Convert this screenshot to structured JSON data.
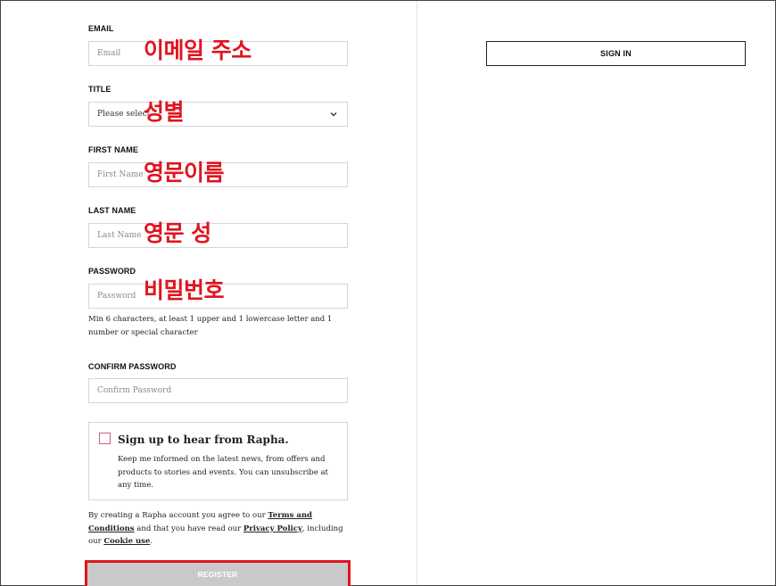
{
  "form": {
    "email": {
      "label": "EMAIL",
      "placeholder": "Email",
      "annotation": "이메일 주소"
    },
    "title": {
      "label": "TITLE",
      "selected": "Please select",
      "annotation": "성별"
    },
    "first_name": {
      "label": "FIRST NAME",
      "placeholder": "First Name",
      "annotation": "영문이름"
    },
    "last_name": {
      "label": "LAST NAME",
      "placeholder": "Last Name",
      "annotation": "영문 성"
    },
    "password": {
      "label": "PASSWORD",
      "placeholder": "Password",
      "annotation": "비밀번호",
      "hint": "Min 6 characters, at least 1 upper and 1 lowercase letter and 1 number or special character"
    },
    "confirm_password": {
      "label": "CONFIRM PASSWORD",
      "placeholder": "Confirm Password"
    },
    "signup": {
      "title": "Sign up to hear from Rapha.",
      "text": "Keep me informed on the latest news, from offers and products to stories and events. You can unsubscribe at any time."
    },
    "legal": {
      "prefix": "By creating a Rapha account you agree to our ",
      "terms": "Terms and Conditions",
      "middle": " and that you have read our ",
      "privacy": "Privacy Policy",
      "middle2": ", including our ",
      "cookie": "Cookie use",
      "suffix": "."
    },
    "register_label": "REGISTER"
  },
  "signin": {
    "label": "SIGN IN"
  },
  "colors": {
    "annotation": "#e0141e",
    "register_bg": "#c9c9c9",
    "checkbox_border": "#d35a7a"
  }
}
